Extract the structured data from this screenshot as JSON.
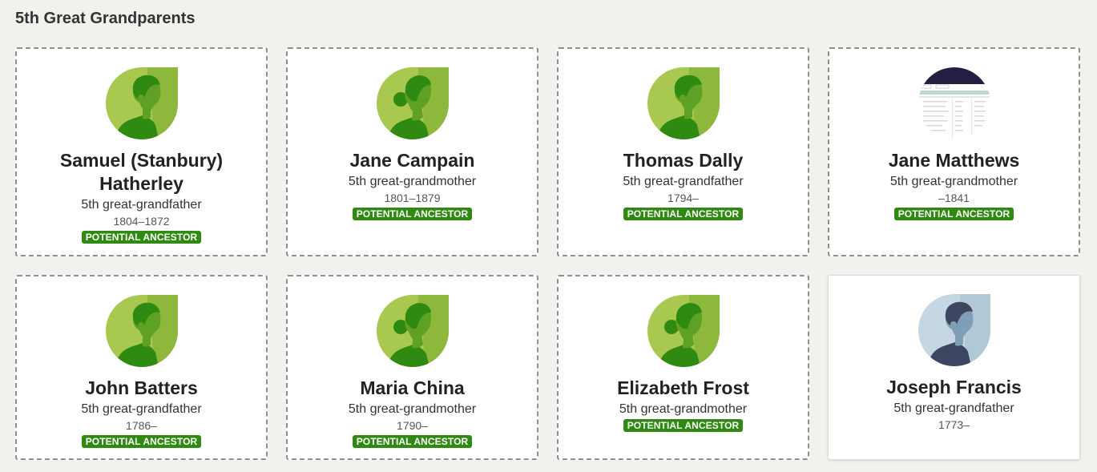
{
  "section": {
    "title": "5th Great Grandparents"
  },
  "colors": {
    "badge_bg": "#2f8a11",
    "green_light": "#a8c84f",
    "green_dark": "#2f8a11",
    "blue_light": "#c4d7e3",
    "blue_dark": "#3c4660"
  },
  "people": [
    {
      "name": "Samuel (Stanbury) Hatherley",
      "relation": "5th great-grandfather",
      "dates": "1804–1872",
      "badge": "POTENTIAL ANCESTOR",
      "avatar": "male-silhouette-icon"
    },
    {
      "name": "Jane Campain",
      "relation": "5th great-grandmother",
      "dates": "1801–1879",
      "badge": "POTENTIAL ANCESTOR",
      "avatar": "female-silhouette-icon"
    },
    {
      "name": "Thomas Dally",
      "relation": "5th great-grandfather",
      "dates": "1794–",
      "badge": "POTENTIAL ANCESTOR",
      "avatar": "male-silhouette-icon"
    },
    {
      "name": "Jane Matthews",
      "relation": "5th great-grandmother",
      "dates": "–1841",
      "badge": "POTENTIAL ANCESTOR",
      "avatar": "document-photo"
    },
    {
      "name": "John Batters",
      "relation": "5th great-grandfather",
      "dates": "1786–",
      "badge": "POTENTIAL ANCESTOR",
      "avatar": "male-silhouette-icon"
    },
    {
      "name": "Maria China",
      "relation": "5th great-grandmother",
      "dates": "1790–",
      "badge": "POTENTIAL ANCESTOR",
      "avatar": "female-silhouette-icon"
    },
    {
      "name": "Elizabeth Frost",
      "relation": "5th great-grandmother",
      "dates": "",
      "badge": "POTENTIAL ANCESTOR",
      "avatar": "female-silhouette-icon"
    },
    {
      "name": "Joseph Francis",
      "relation": "5th great-grandfather",
      "dates": "1773–",
      "badge": "",
      "avatar": "male-silhouette-blue-icon"
    }
  ]
}
